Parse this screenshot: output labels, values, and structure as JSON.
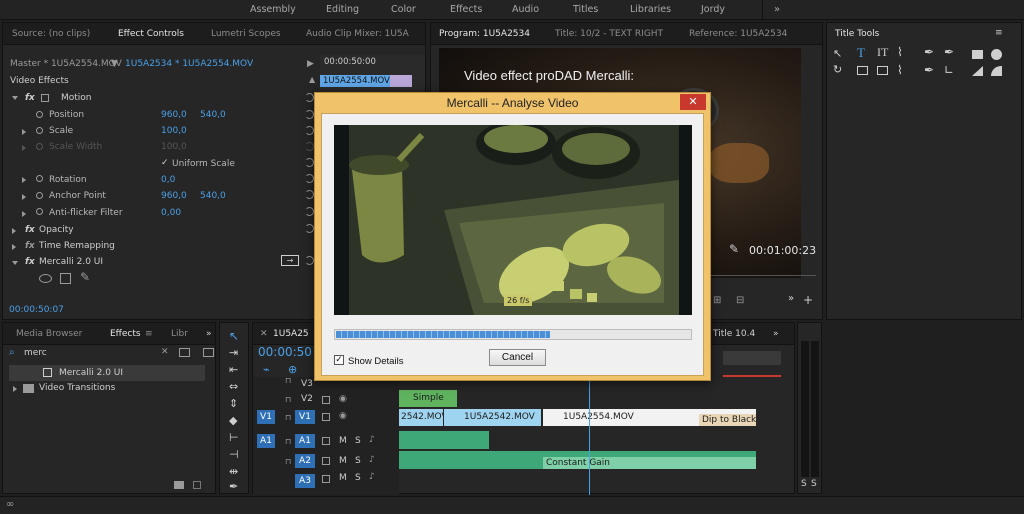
{
  "workspaces": [
    "Assembly",
    "Editing",
    "Color",
    "Effects",
    "Audio",
    "Titles",
    "Libraries",
    "Jordy"
  ],
  "source_panel": {
    "tabs": [
      "Source: (no clips)",
      "Effect Controls",
      "Lumetri Scopes",
      "Audio Clip Mixer: 1U5A"
    ],
    "master_label": "Master * 1U5A2554.MOV",
    "clip_label": "1U5A2534 * 1U5A2554.MOV",
    "mini_time": "00:00:50:00",
    "mini_clip": "1U5A2554.MOV",
    "section": "Video Effects",
    "effects": [
      {
        "name": "Motion",
        "fx": "fx"
      },
      {
        "name": "Opacity",
        "fx": "fx"
      },
      {
        "name": "Time Remapping",
        "fx": "fx"
      },
      {
        "name": "Mercalli 2.0 UI",
        "fx": "fx"
      }
    ],
    "props": [
      {
        "name": "Position",
        "v1": "960,0",
        "v2": "540,0"
      },
      {
        "name": "Scale",
        "v1": "100,0",
        "v2": ""
      },
      {
        "name": "Scale Width",
        "v1": "100,0",
        "v2": ""
      },
      {
        "name": "Rotation",
        "v1": "0,0",
        "v2": ""
      },
      {
        "name": "Anchor Point",
        "v1": "960,0",
        "v2": "540,0"
      },
      {
        "name": "Anti-flicker Filter",
        "v1": "0,00",
        "v2": ""
      }
    ],
    "uniform_scale": "Uniform Scale",
    "timecode": "00:00:50:07"
  },
  "program_panel": {
    "tabs": [
      "Program: 1U5A2534",
      "Title: 10/2 - TEXT RIGHT",
      "Reference: 1U5A2534"
    ],
    "overlay_text": "Video effect proDAD Mercalli:",
    "timecode": "00:01:00:23"
  },
  "title_tools": {
    "title": "Title Tools"
  },
  "media_panel": {
    "tabs": [
      "Media Browser",
      "Effects",
      "Libr"
    ],
    "search_value": "merc",
    "items": [
      "Mercalli 2.0 UI",
      "Video Transitions"
    ]
  },
  "timeline": {
    "tab": "1U5A25",
    "title_tab": "Title 10.4",
    "timecode": "00:00:50",
    "tracks": [
      {
        "id": "V3",
        "src": ""
      },
      {
        "id": "V2",
        "src": ""
      },
      {
        "id": "V1",
        "src": "V1"
      },
      {
        "id": "A1",
        "src": "A1"
      },
      {
        "id": "A2",
        "src": ""
      },
      {
        "id": "A3",
        "src": ""
      }
    ],
    "clips": {
      "simple": "Simple",
      "c1": "2542.MOV",
      "c2": "1U5A2542.MOV",
      "c3": "1U5A2554.MOV",
      "dip": "Dip to Black",
      "gain": "Constant Gain"
    },
    "meter_labels": [
      "S",
      "S"
    ]
  },
  "dialog": {
    "title": "Mercalli -- Analyse Video",
    "close": "✕",
    "fps": "26 f/s",
    "progress": 0.6,
    "show_details": "Show Details",
    "cancel": "Cancel"
  },
  "colors": {
    "accent": "#4aa0e8",
    "dialog_frame": "#f0c36a",
    "close": "#c9382d",
    "progress": "#4b8fd6"
  }
}
